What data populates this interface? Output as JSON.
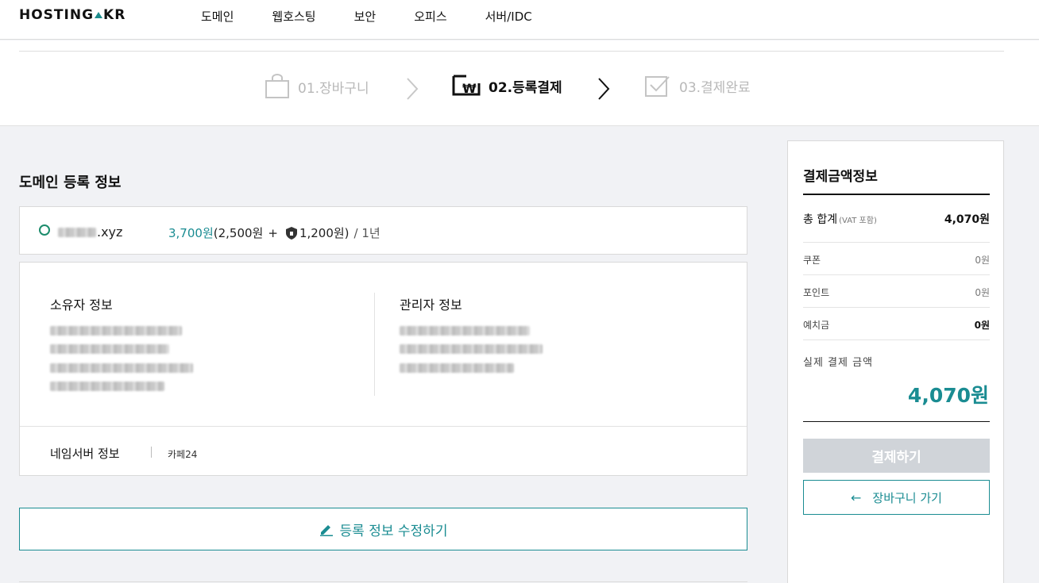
{
  "header": {
    "logo_text": "HOSTING.KR",
    "nav": [
      "도메인",
      "웹호스팅",
      "보안",
      "오피스",
      "서버/IDC"
    ]
  },
  "steps": {
    "step1": "01.장바구니",
    "step2": "02.등록결제",
    "step3": "03.결제완료"
  },
  "main": {
    "section_title": "도메인 등록 정보",
    "domain": {
      "name_suffix": ".xyz",
      "price_total": "3,700원",
      "price_base": "(2,500원",
      "plus": "+",
      "price_security": "1,200원)",
      "period": "/ 1년"
    },
    "owner_title": "소유자 정보",
    "admin_title": "관리자 정보",
    "nameserver_title": "네임서버 정보",
    "nameserver_value": "카페24",
    "edit_button": "등록 정보 수정하기"
  },
  "summary": {
    "title": "결제금액정보",
    "total_label": "총 합계",
    "total_note": "(VAT 포함)",
    "total_value": "4,070원",
    "coupon_label": "쿠폰",
    "coupon_value": "0원",
    "point_label": "포인트",
    "point_value": "0원",
    "deposit_label": "예치금",
    "deposit_value": "0원",
    "final_label": "실제 결제 금액",
    "final_value": "4,070원",
    "pay_button": "결제하기",
    "cart_button": "장바구니 가기"
  },
  "colors": {
    "accent": "#1a8c92",
    "disabled_button": "#d0d4d9"
  }
}
